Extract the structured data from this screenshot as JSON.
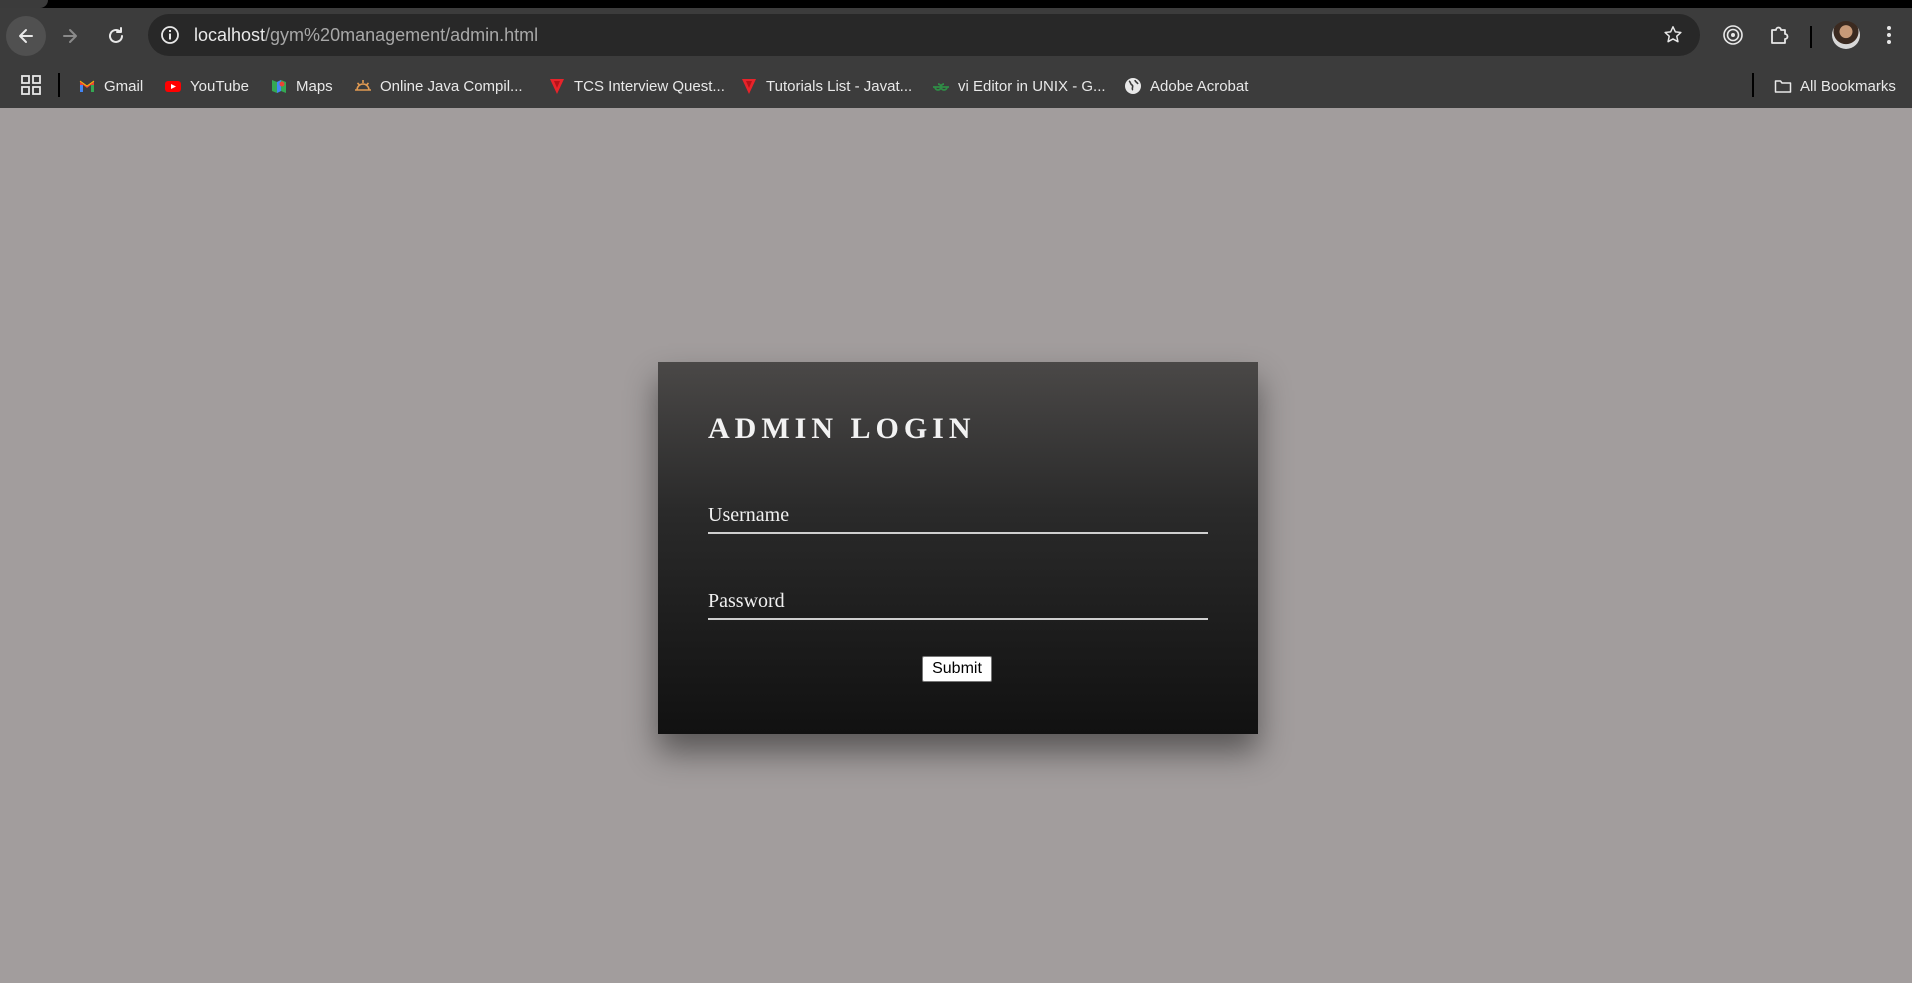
{
  "browser": {
    "url_host": "localhost",
    "url_path": "/gym%20management/admin.html",
    "icons": {
      "back": "back-arrow-icon",
      "forward": "forward-arrow-icon",
      "reload": "reload-icon",
      "site_info": "info-icon",
      "bookmark": "star-icon",
      "extension": "target-icon",
      "extensions": "puzzle-icon",
      "menu": "kebab-menu-icon"
    }
  },
  "bookmarks": {
    "items": [
      {
        "label": "Gmail",
        "icon": "gmail-icon"
      },
      {
        "label": "YouTube",
        "icon": "youtube-icon"
      },
      {
        "label": "Maps",
        "icon": "maps-icon"
      },
      {
        "label": "Online Java Compil...",
        "icon": "sun-icon"
      },
      {
        "label": "TCS Interview Quest...",
        "icon": "shield-icon"
      },
      {
        "label": "Tutorials List - Javat...",
        "icon": "shield-icon"
      },
      {
        "label": "vi Editor in UNIX - G...",
        "icon": "gfg-icon"
      },
      {
        "label": "Adobe Acrobat",
        "icon": "globe-icon"
      }
    ],
    "all_bookmarks_label": "All Bookmarks"
  },
  "login": {
    "title": "ADMIN LOGIN",
    "username_label": "Username",
    "password_label": "Password",
    "submit_label": "Submit"
  },
  "colors": {
    "page_background": "#a29d9d",
    "card_top": "#4a4847",
    "card_bottom": "#111111",
    "toolbar": "#3c3c3c"
  }
}
